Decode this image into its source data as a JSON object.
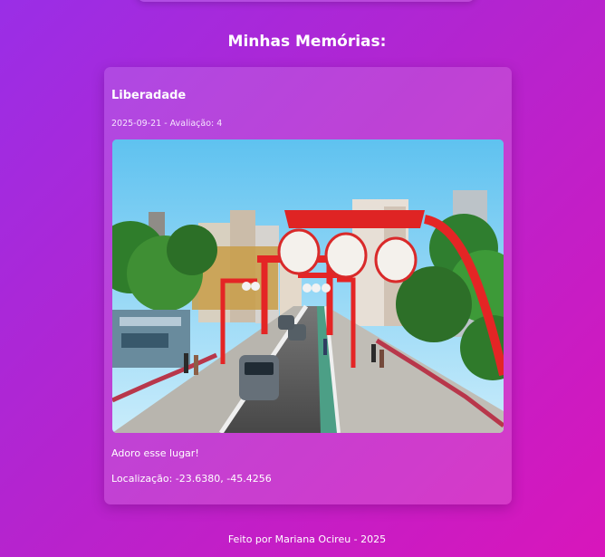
{
  "section": {
    "title": "Minhas Memórias:"
  },
  "memories": [
    {
      "title": "Liberadade",
      "meta": "2025-09-21 - Avaliação: 4",
      "description": "Adoro esse lugar!",
      "location": "Localização: -23.6380, -45.4256"
    }
  ],
  "footer": {
    "text": "Feito por Mariana Ocireu - 2025"
  },
  "colors": {
    "background_start": "#9a2ee6",
    "background_end": "#d816bb",
    "card_background": "rgba(255,255,255,0.14)",
    "text": "#ffffff"
  },
  "icons": {
    "photo": "street-photo-icon"
  }
}
